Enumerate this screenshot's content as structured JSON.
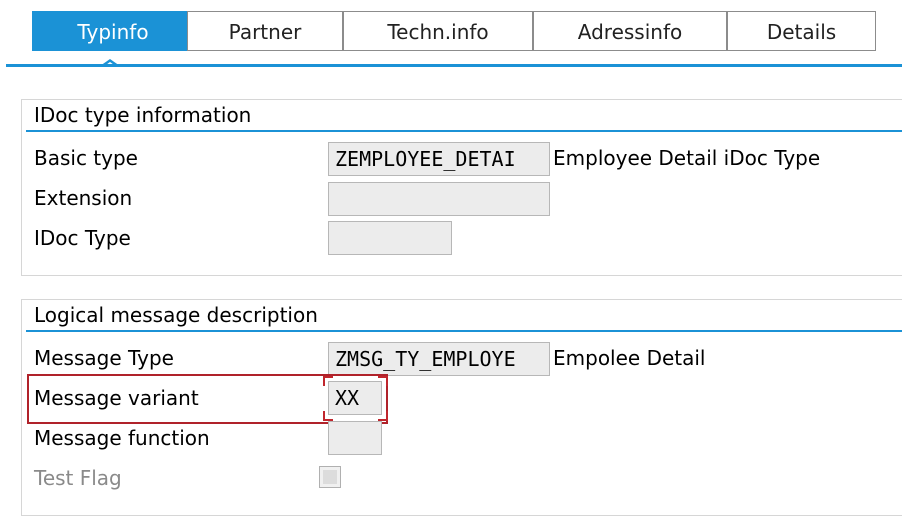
{
  "tabs": [
    {
      "label": "Typinfo",
      "active": true
    },
    {
      "label": "Partner",
      "active": false
    },
    {
      "label": "Techn.info",
      "active": false
    },
    {
      "label": "Adressinfo",
      "active": false
    },
    {
      "label": "Details",
      "active": false
    }
  ],
  "idoc_type_info": {
    "title": "IDoc type information",
    "basic_type": {
      "label": "Basic type",
      "value": "ZEMPLOYEE_DETAI",
      "description": "Employee Detail iDoc Type"
    },
    "extension": {
      "label": "Extension",
      "value": ""
    },
    "idoc_type": {
      "label": "IDoc Type",
      "value": ""
    }
  },
  "logical_message": {
    "title": "Logical message description",
    "message_type": {
      "label": "Message Type",
      "value": "ZMSG_TY_EMPLOYE",
      "description": "Empolee Detail"
    },
    "message_variant": {
      "label": "Message variant",
      "value": "XX"
    },
    "message_function": {
      "label": "Message function",
      "value": ""
    },
    "test_flag": {
      "label": "Test Flag",
      "checked": false,
      "enabled": false
    }
  },
  "colors": {
    "accent": "#1b92d6",
    "highlight": "#b0222a"
  }
}
